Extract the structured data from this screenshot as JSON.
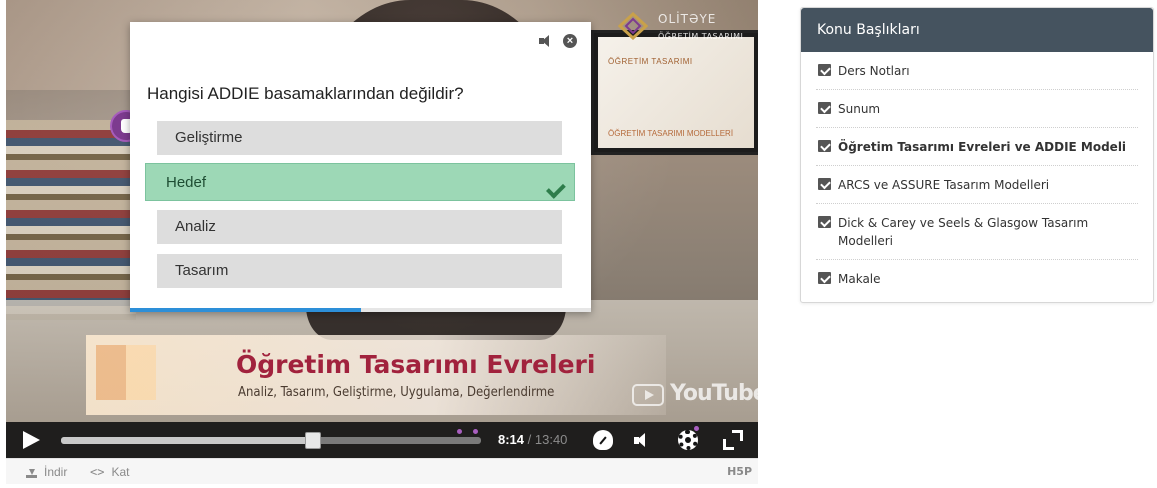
{
  "player": {
    "lower_third": {
      "title": "Öğretim Tasarımı Evreleri",
      "subtitle": "Analiz, Tasarım, Geliştirme, Uygulama, Değerlendirme"
    },
    "logo": {
      "top_text": "OLİTƏYE",
      "sub_text": "ÖĞRETİM TASARIMI"
    },
    "monitor": {
      "line1": "ÖĞRETİM TASARIMI",
      "line2": "ÖĞRETİM TASARIMI MODELLERİ"
    },
    "watermark": "YouTube",
    "quiz": {
      "question": "Hangisi ADDIE basamaklarından değildir?",
      "options": [
        {
          "label": "Geliştirme",
          "state": "default"
        },
        {
          "label": "Hedef",
          "state": "correct"
        },
        {
          "label": "Analiz",
          "state": "default"
        },
        {
          "label": "Tasarım",
          "state": "default"
        }
      ],
      "progress_fraction": 0.5,
      "icons": {
        "audio": "speaker-icon",
        "close": "close-icon",
        "correct": "check-icon"
      }
    },
    "controls": {
      "current_time": "8:14",
      "total_time": "/ 13:40",
      "played_fraction": 0.6,
      "icons": [
        "play-icon",
        "quality-icon",
        "volume-icon",
        "gear-icon",
        "fullscreen-icon"
      ],
      "accent_color": "#a95fc0"
    },
    "footer": {
      "download_label": "İndir",
      "embed_label": "Kat",
      "brand": "H5P"
    }
  },
  "topics": {
    "header": "Konu Başlıkları",
    "items": [
      {
        "label": "Ders Notları",
        "active": false
      },
      {
        "label": "Sunum",
        "active": false
      },
      {
        "label": "Öğretim Tasarımı Evreleri ve ADDIE Modeli",
        "active": true
      },
      {
        "label": "ARCS ve ASSURE Tasarım Modelleri",
        "active": false
      },
      {
        "label": "Dick & Carey ve Seels & Glasgow Tasarım Modelleri",
        "active": false
      },
      {
        "label": "Makale",
        "active": false
      }
    ],
    "header_color": "#45535f"
  }
}
